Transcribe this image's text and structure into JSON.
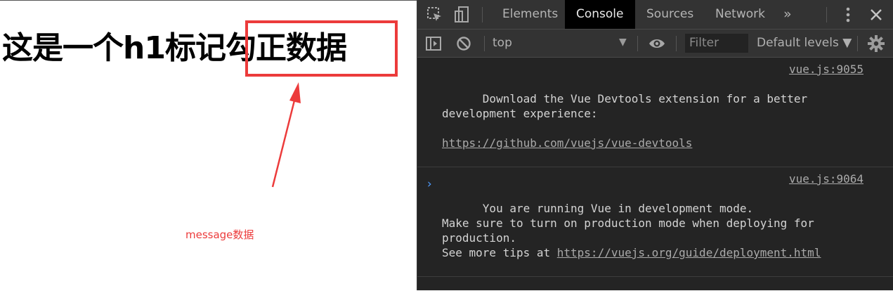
{
  "page": {
    "heading": "这是一个h1标记勾正数据",
    "annotation": {
      "text": "message数据",
      "color": "#ec3b3b"
    }
  },
  "devtools": {
    "tabs": [
      {
        "label": "Elements",
        "active": false
      },
      {
        "label": "Console",
        "active": true
      },
      {
        "label": "Sources",
        "active": false
      },
      {
        "label": "Network",
        "active": false
      }
    ],
    "more_tabs": "»",
    "toolbar": {
      "context": "top",
      "context_arrow": "▼",
      "filter_placeholder": "Filter",
      "levels": "Default levels ▼"
    },
    "messages": [
      {
        "text": "Download the Vue Devtools extension for a better\ndevelopment experience:",
        "link": "https://github.com/vuejs/vue-devtools",
        "source": "vue.js:9055"
      },
      {
        "text": "You are running Vue in development mode.\nMake sure to turn on production mode when deploying for\nproduction.\nSee more tips at ",
        "link": "https://vuejs.org/guide/deployment.html",
        "source": "vue.js:9064"
      }
    ],
    "prompt": "›"
  },
  "icons": {
    "inspect": "inspect-element-icon",
    "device": "device-toggle-icon",
    "kebab": "more-vert-icon",
    "close": "close-icon",
    "sidebar": "sidebar-toggle-icon",
    "clear": "clear-console-icon",
    "eye": "live-expression-icon",
    "gear": "settings-gear-icon"
  },
  "colors": {
    "accent": "#ec3b3b",
    "devtools_bg": "#242424",
    "prompt": "#4e9cff"
  }
}
